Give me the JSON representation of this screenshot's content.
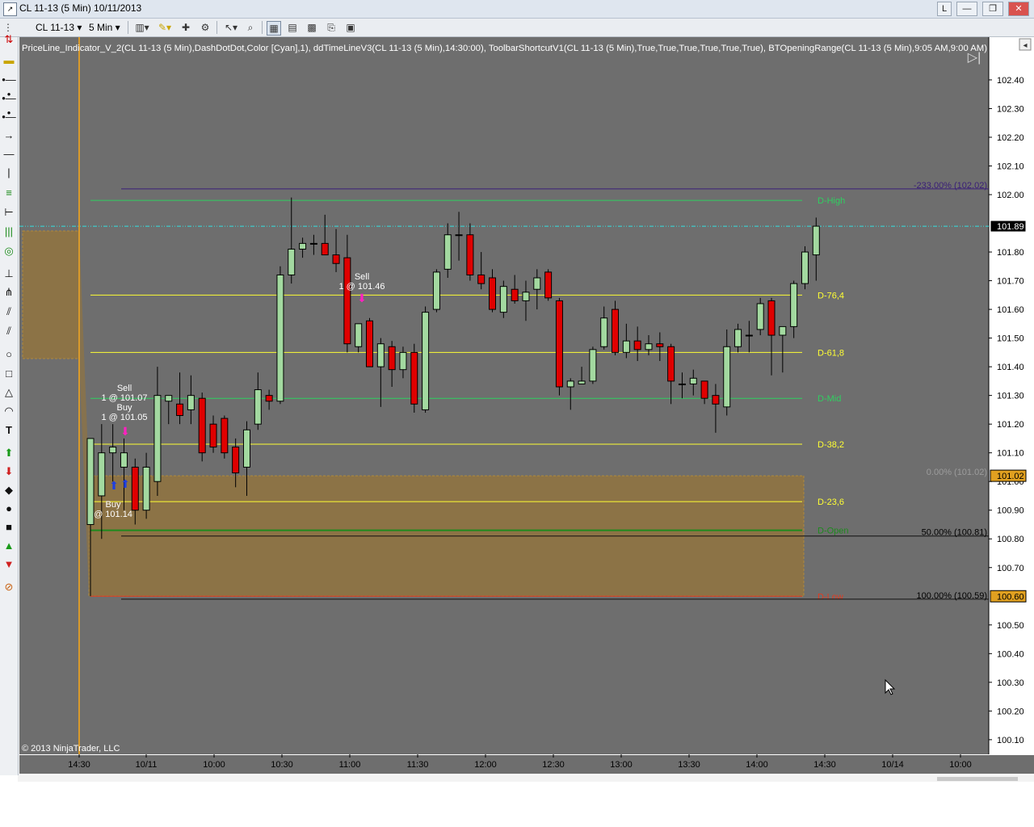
{
  "window": {
    "title": "CL 11-13 (5 Min)  10/11/2013",
    "buttons": [
      "L",
      "—",
      "❐",
      "✕"
    ]
  },
  "toolbar": {
    "instrument": "CL 11-13",
    "interval": "5 Min"
  },
  "indicator_label": "PriceLine_Indicator_V_2(CL 11-13 (5 Min),DashDotDot,Color [Cyan],1), ddTimeLineV3(CL 11-13 (5 Min),14:30:00), ToolbarShortcutV1(CL 11-13 (5 Min),True,True,True,True,True,True), BTOpeningRange(CL 11-13 (5 Min),9:05 AM,9:00 AM)",
  "copyright": "© 2013 NinjaTrader, LLC",
  "colors": {
    "chart_bg": "#6e6e6e",
    "up_candle": "#a3d9a0",
    "down_candle": "#e00000",
    "range_box": "#8c7346",
    "level_yellow": "#ffff33",
    "level_green": "#2fd060",
    "time_line": "#d99a2b"
  },
  "chart_data": {
    "type": "candlestick",
    "instrument": "CL 11-13",
    "interval": "5 Min",
    "ylim": [
      100.05,
      102.5
    ],
    "price_ticks": [
      "102.40",
      "102.30",
      "102.20",
      "102.10",
      "102.00",
      "101.80",
      "101.70",
      "101.60",
      "101.50",
      "101.40",
      "101.30",
      "101.20",
      "101.10",
      "101.00",
      "100.90",
      "100.80",
      "100.70",
      "100.50",
      "100.40",
      "100.30",
      "100.20",
      "100.10"
    ],
    "time_ticks": [
      "14:30",
      "10/11",
      "10:00",
      "10:30",
      "11:00",
      "11:30",
      "12:00",
      "12:30",
      "13:00",
      "13:30",
      "14:00",
      "14:30",
      "10/14",
      "10:00"
    ],
    "current_price": "101.89",
    "candles": [
      {
        "t": 0,
        "o": 100.85,
        "h": 101.15,
        "l": 100.6,
        "c": 101.15
      },
      {
        "t": 1,
        "o": 100.95,
        "h": 101.2,
        "l": 100.8,
        "c": 101.1
      },
      {
        "t": 2,
        "o": 101.1,
        "h": 101.2,
        "l": 101.0,
        "c": 101.12
      },
      {
        "t": 3,
        "o": 101.05,
        "h": 101.15,
        "l": 100.9,
        "c": 101.1
      },
      {
        "t": 4,
        "o": 101.05,
        "h": 101.08,
        "l": 100.85,
        "c": 100.9
      },
      {
        "t": 5,
        "o": 100.9,
        "h": 101.1,
        "l": 100.87,
        "c": 101.05
      },
      {
        "t": 6,
        "o": 101.0,
        "h": 101.4,
        "l": 100.95,
        "c": 101.3
      },
      {
        "t": 7,
        "o": 101.28,
        "h": 101.3,
        "l": 101.2,
        "c": 101.3
      },
      {
        "t": 8,
        "o": 101.27,
        "h": 101.38,
        "l": 101.2,
        "c": 101.23
      },
      {
        "t": 9,
        "o": 101.25,
        "h": 101.37,
        "l": 101.2,
        "c": 101.3
      },
      {
        "t": 10,
        "o": 101.29,
        "h": 101.31,
        "l": 101.07,
        "c": 101.1
      },
      {
        "t": 11,
        "o": 101.2,
        "h": 101.23,
        "l": 101.1,
        "c": 101.12
      },
      {
        "t": 12,
        "o": 101.22,
        "h": 101.23,
        "l": 101.08,
        "c": 101.1
      },
      {
        "t": 13,
        "o": 101.12,
        "h": 101.15,
        "l": 100.98,
        "c": 101.03
      },
      {
        "t": 14,
        "o": 101.05,
        "h": 101.21,
        "l": 100.95,
        "c": 101.18
      },
      {
        "t": 15,
        "o": 101.2,
        "h": 101.38,
        "l": 101.18,
        "c": 101.32
      },
      {
        "t": 16,
        "o": 101.3,
        "h": 101.32,
        "l": 101.25,
        "c": 101.28
      },
      {
        "t": 17,
        "o": 101.28,
        "h": 101.75,
        "l": 101.27,
        "c": 101.72
      },
      {
        "t": 18,
        "o": 101.72,
        "h": 101.99,
        "l": 101.69,
        "c": 101.81
      },
      {
        "t": 19,
        "o": 101.81,
        "h": 101.85,
        "l": 101.78,
        "c": 101.83
      },
      {
        "t": 20,
        "o": 101.83,
        "h": 101.86,
        "l": 101.79,
        "c": 101.83
      },
      {
        "t": 21,
        "o": 101.83,
        "h": 101.93,
        "l": 101.8,
        "c": 101.79
      },
      {
        "t": 22,
        "o": 101.79,
        "h": 101.88,
        "l": 101.73,
        "c": 101.76
      },
      {
        "t": 23,
        "o": 101.78,
        "h": 101.86,
        "l": 101.45,
        "c": 101.48
      },
      {
        "t": 24,
        "o": 101.47,
        "h": 101.53,
        "l": 101.45,
        "c": 101.55
      },
      {
        "t": 25,
        "o": 101.56,
        "h": 101.57,
        "l": 101.42,
        "c": 101.4
      },
      {
        "t": 26,
        "o": 101.4,
        "h": 101.5,
        "l": 101.26,
        "c": 101.48
      },
      {
        "t": 27,
        "o": 101.47,
        "h": 101.49,
        "l": 101.33,
        "c": 101.39
      },
      {
        "t": 28,
        "o": 101.39,
        "h": 101.47,
        "l": 101.36,
        "c": 101.45
      },
      {
        "t": 29,
        "o": 101.45,
        "h": 101.48,
        "l": 101.24,
        "c": 101.27
      },
      {
        "t": 30,
        "o": 101.25,
        "h": 101.61,
        "l": 101.24,
        "c": 101.59
      },
      {
        "t": 31,
        "o": 101.6,
        "h": 101.74,
        "l": 101.59,
        "c": 101.73
      },
      {
        "t": 32,
        "o": 101.74,
        "h": 101.9,
        "l": 101.71,
        "c": 101.86
      },
      {
        "t": 33,
        "o": 101.86,
        "h": 101.94,
        "l": 101.77,
        "c": 101.86
      },
      {
        "t": 34,
        "o": 101.86,
        "h": 101.9,
        "l": 101.7,
        "c": 101.72
      },
      {
        "t": 35,
        "o": 101.72,
        "h": 101.8,
        "l": 101.67,
        "c": 101.69
      },
      {
        "t": 36,
        "o": 101.71,
        "h": 101.74,
        "l": 101.59,
        "c": 101.6
      },
      {
        "t": 37,
        "o": 101.59,
        "h": 101.7,
        "l": 101.57,
        "c": 101.68
      },
      {
        "t": 38,
        "o": 101.67,
        "h": 101.72,
        "l": 101.62,
        "c": 101.63
      },
      {
        "t": 39,
        "o": 101.63,
        "h": 101.7,
        "l": 101.56,
        "c": 101.66
      },
      {
        "t": 40,
        "o": 101.67,
        "h": 101.74,
        "l": 101.6,
        "c": 101.71
      },
      {
        "t": 41,
        "o": 101.73,
        "h": 101.74,
        "l": 101.63,
        "c": 101.64
      },
      {
        "t": 42,
        "o": 101.63,
        "h": 101.64,
        "l": 101.3,
        "c": 101.33
      },
      {
        "t": 43,
        "o": 101.33,
        "h": 101.36,
        "l": 101.25,
        "c": 101.35
      },
      {
        "t": 44,
        "o": 101.34,
        "h": 101.4,
        "l": 101.34,
        "c": 101.35
      },
      {
        "t": 45,
        "o": 101.35,
        "h": 101.47,
        "l": 101.34,
        "c": 101.46
      },
      {
        "t": 46,
        "o": 101.47,
        "h": 101.61,
        "l": 101.46,
        "c": 101.57
      },
      {
        "t": 47,
        "o": 101.6,
        "h": 101.63,
        "l": 101.44,
        "c": 101.45
      },
      {
        "t": 48,
        "o": 101.45,
        "h": 101.55,
        "l": 101.43,
        "c": 101.49
      },
      {
        "t": 49,
        "o": 101.49,
        "h": 101.54,
        "l": 101.42,
        "c": 101.46
      },
      {
        "t": 50,
        "o": 101.46,
        "h": 101.51,
        "l": 101.44,
        "c": 101.48
      },
      {
        "t": 51,
        "o": 101.48,
        "h": 101.52,
        "l": 101.42,
        "c": 101.47
      },
      {
        "t": 52,
        "o": 101.47,
        "h": 101.48,
        "l": 101.27,
        "c": 101.35
      },
      {
        "t": 53,
        "o": 101.34,
        "h": 101.38,
        "l": 101.29,
        "c": 101.34
      },
      {
        "t": 54,
        "o": 101.34,
        "h": 101.39,
        "l": 101.3,
        "c": 101.36
      },
      {
        "t": 55,
        "o": 101.35,
        "h": 101.35,
        "l": 101.27,
        "c": 101.29
      },
      {
        "t": 56,
        "o": 101.3,
        "h": 101.34,
        "l": 101.17,
        "c": 101.27
      },
      {
        "t": 57,
        "o": 101.26,
        "h": 101.53,
        "l": 101.23,
        "c": 101.47
      },
      {
        "t": 58,
        "o": 101.47,
        "h": 101.55,
        "l": 101.45,
        "c": 101.53
      },
      {
        "t": 59,
        "o": 101.51,
        "h": 101.56,
        "l": 101.45,
        "c": 101.51
      },
      {
        "t": 60,
        "o": 101.53,
        "h": 101.64,
        "l": 101.51,
        "c": 101.62
      },
      {
        "t": 61,
        "o": 101.63,
        "h": 101.64,
        "l": 101.37,
        "c": 101.51
      },
      {
        "t": 62,
        "o": 101.51,
        "h": 101.53,
        "l": 101.38,
        "c": 101.54
      },
      {
        "t": 63,
        "o": 101.54,
        "h": 101.7,
        "l": 101.5,
        "c": 101.69
      },
      {
        "t": 64,
        "o": 101.69,
        "h": 101.82,
        "l": 101.67,
        "c": 101.8
      },
      {
        "t": 65,
        "o": 101.79,
        "h": 101.92,
        "l": 101.7,
        "c": 101.89
      }
    ],
    "levels": [
      {
        "name": "D-High",
        "price": 101.98,
        "color": "#2fd060"
      },
      {
        "name": "D-76,4",
        "price": 101.65,
        "color": "#ffff33"
      },
      {
        "name": "D-61,8",
        "price": 101.45,
        "color": "#ffff33"
      },
      {
        "name": "D-Mid",
        "price": 101.29,
        "color": "#2fd060"
      },
      {
        "name": "D-38,2",
        "price": 101.13,
        "color": "#ffff33"
      },
      {
        "name": "D-23,6",
        "price": 100.93,
        "color": "#ffff33"
      },
      {
        "name": "D-Open",
        "price": 100.83,
        "color": "#1e8a1e"
      },
      {
        "name": "D-Low",
        "price": 100.6,
        "color": "#e23b20"
      }
    ],
    "fib_labels": [
      {
        "text": "-233.00% (102.02)",
        "price": 102.02,
        "color": "#3a1e78"
      },
      {
        "text": "0.00% (101.02)",
        "price": 101.02,
        "color": "#9c9c9c"
      },
      {
        "text": "50.00% (100.81)",
        "price": 100.81,
        "color": "#000000"
      },
      {
        "text": "100.00% (100.59)",
        "price": 100.59,
        "color": "#000000"
      }
    ],
    "price_markers": [
      {
        "text": "101.02",
        "price": 101.02,
        "bg": "#e0a020"
      },
      {
        "text": "100.60",
        "price": 100.6,
        "bg": "#e0a020"
      }
    ],
    "trade_labels": [
      {
        "text": "Sell",
        "sub": "1 @ 101.07",
        "t": 1
      },
      {
        "text": "Buy",
        "sub": "1 @ 101.05",
        "t": 1
      },
      {
        "text": "Buy",
        "sub": "@ 101.14",
        "t": 0
      },
      {
        "text": "Sell",
        "sub": "1 @ 101.46",
        "t": 23
      }
    ]
  }
}
